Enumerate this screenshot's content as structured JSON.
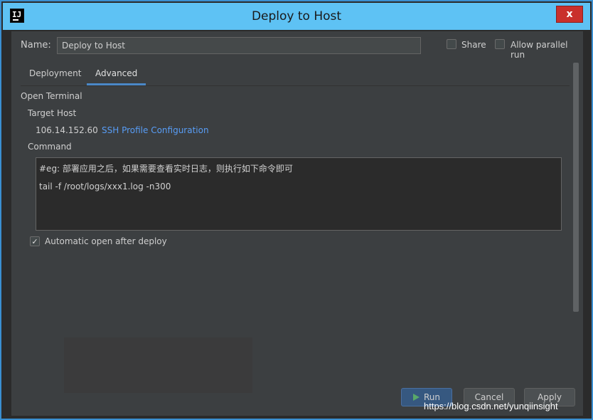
{
  "window": {
    "title": "Deploy to Host",
    "app_icon_text": "IJ",
    "close_label": "x"
  },
  "form": {
    "name_label": "Name:",
    "name_value": "Deploy to Host",
    "share_label": "Share",
    "parallel_label": "Allow parallel run"
  },
  "tabs": [
    {
      "label": "Deployment",
      "active": false
    },
    {
      "label": "Advanced",
      "active": true
    }
  ],
  "advanced": {
    "open_terminal": "Open Terminal",
    "target_host": "Target Host",
    "host_ip": "106.14.152.60",
    "ssh_link": "SSH Profile Configuration",
    "command_label": "Command",
    "command_lines": [
      "#eg: 部署应用之后，如果需要查看实时日志，则执行如下命令即可",
      "tail -f /root/logs/xxx1.log -n300"
    ],
    "auto_open_label": "Automatic open after deploy",
    "auto_open_checked": true
  },
  "buttons": {
    "run": "Run",
    "cancel": "Cancel",
    "apply": "Apply"
  },
  "watermark": "https://blog.csdn.net/yunqiinsight",
  "colors": {
    "titlebar": "#5ec2f4",
    "panel": "#3c3f41",
    "link": "#589df6",
    "accent": "#4a88c7"
  }
}
